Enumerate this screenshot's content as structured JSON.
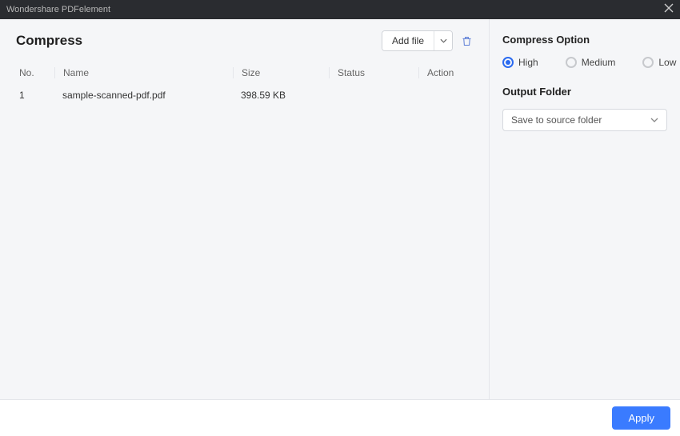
{
  "titlebar": {
    "app_name": "Wondershare PDFelement"
  },
  "page": {
    "title": "Compress",
    "add_file_label": "Add file"
  },
  "table": {
    "headers": {
      "no": "No.",
      "name": "Name",
      "size": "Size",
      "status": "Status",
      "action": "Action"
    },
    "rows": [
      {
        "no": "1",
        "name": "sample-scanned-pdf.pdf",
        "size": "398.59 KB",
        "status": "",
        "action": ""
      }
    ]
  },
  "options": {
    "section_title": "Compress Option",
    "levels": {
      "high": "High",
      "medium": "Medium",
      "low": "Low"
    },
    "selected": "high",
    "output_folder_title": "Output Folder",
    "output_folder_value": "Save to source folder"
  },
  "footer": {
    "apply_label": "Apply"
  }
}
